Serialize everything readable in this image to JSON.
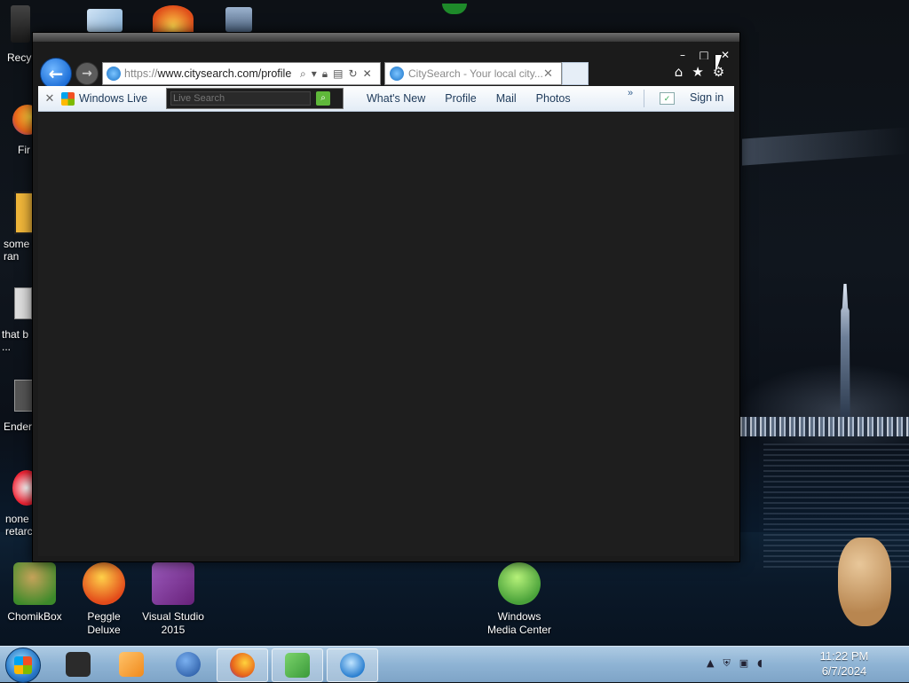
{
  "desktop": {
    "icons_left_partial": [
      {
        "name": "recycle-bin",
        "label": "Recy"
      },
      {
        "name": "firefox",
        "label": "Fir"
      },
      {
        "name": "some-ran",
        "label": "some\nran"
      },
      {
        "name": "that-b",
        "label": "that b\n..."
      },
      {
        "name": "ender",
        "label": "Ender"
      },
      {
        "name": "none-retard",
        "label": "none\nretarc"
      }
    ],
    "icons_bottom": [
      {
        "name": "chomikbox",
        "label": "ChomikBox",
        "color": "#3d8a2a"
      },
      {
        "name": "peggle-deluxe",
        "label": "Peggle Deluxe",
        "color": "#e34b1a"
      },
      {
        "name": "visual-studio-2015",
        "label": "Visual Studio 2015",
        "color": "#68217a"
      },
      {
        "name": "windows-media-center",
        "label": "Windows Media Center",
        "color": "#4aa23a"
      }
    ]
  },
  "browser": {
    "address_url_proto": "https://",
    "address_url_rest": "www.citysearch.com/profile",
    "tab_title": "CitySearch - Your local city...",
    "window_controls": {
      "minimize": "–",
      "maximize": "□",
      "close": "✕"
    },
    "right_tools": {
      "home": "⌂",
      "favorites": "★",
      "settings": "⚙"
    }
  },
  "wl_toolbar": {
    "brand": "Windows Live",
    "search_placeholder": "Live Search",
    "links": [
      "What's New",
      "Profile",
      "Mail",
      "Photos"
    ],
    "more": "»",
    "sign_in": "Sign in"
  },
  "taskbar": {
    "apps": [
      {
        "name": "explorer",
        "color": "#2b2b2b"
      },
      {
        "name": "media-player",
        "color": "#f08a1c"
      },
      {
        "name": "network-globe",
        "color": "#1f4f9a"
      },
      {
        "name": "firefox",
        "color": "#e8661a"
      },
      {
        "name": "live-messenger",
        "color": "#3a9a3a"
      },
      {
        "name": "internet-explorer",
        "color": "#2a7fd0"
      }
    ],
    "time": "11:22 PM",
    "date": "6/7/2024"
  },
  "colors": {
    "ie_blue": "#1d6fd8",
    "taskbar": "#8eb3d4",
    "content_bg": "#1e1e1e"
  }
}
